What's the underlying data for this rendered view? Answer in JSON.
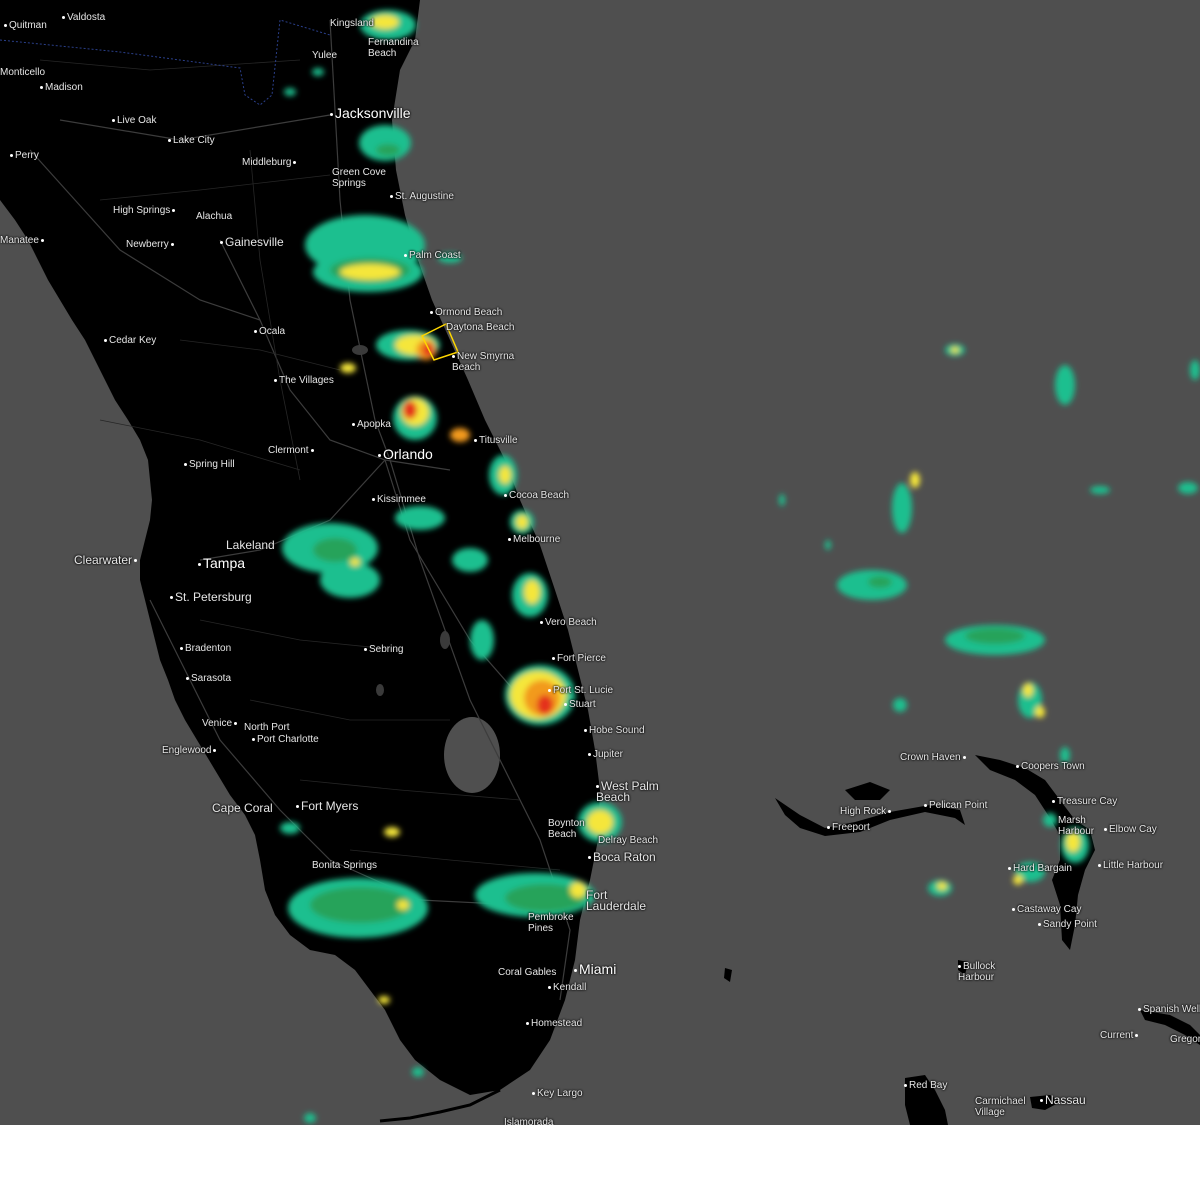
{
  "map": {
    "places": [
      {
        "name": "Valdosta",
        "size": "small"
      },
      {
        "name": "Quitman",
        "size": "small"
      },
      {
        "name": "Madison",
        "size": "small"
      },
      {
        "name": "Live Oak",
        "size": "small"
      },
      {
        "name": "Lake City",
        "size": "small"
      },
      {
        "name": "Perry",
        "size": "small"
      },
      {
        "name": "High Springs",
        "size": "small"
      },
      {
        "name": "Alachua",
        "size": "small"
      },
      {
        "name": "Newberry",
        "size": "small"
      },
      {
        "name": "Gainesville",
        "size": "medium"
      },
      {
        "name": "Cedar Key",
        "size": "small"
      },
      {
        "name": "Ocala",
        "size": "small"
      },
      {
        "name": "The Villages",
        "size": "small"
      },
      {
        "name": "Jacksonville",
        "size": "large"
      },
      {
        "name": "Middleburg",
        "size": "small"
      },
      {
        "name": "Green Cove Springs",
        "size": "small"
      },
      {
        "name": "Yulee",
        "size": "small"
      },
      {
        "name": "St. Augustine",
        "size": "small"
      },
      {
        "name": "Palm Coast",
        "size": "small"
      },
      {
        "name": "Ormond Beach",
        "size": "small"
      },
      {
        "name": "Daytona Beach",
        "size": "small"
      },
      {
        "name": "New Smyrna Beach",
        "size": "small"
      },
      {
        "name": "Apopka",
        "size": "small"
      },
      {
        "name": "Orlando",
        "size": "large"
      },
      {
        "name": "Titusville",
        "size": "small"
      },
      {
        "name": "Clermont",
        "size": "small"
      },
      {
        "name": "Spring Hill",
        "size": "small"
      },
      {
        "name": "Kissimmee",
        "size": "small"
      },
      {
        "name": "Cocoa Beach",
        "size": "small"
      },
      {
        "name": "Melbourne",
        "size": "small"
      },
      {
        "name": "Lakeland",
        "size": "medium"
      },
      {
        "name": "Tampa",
        "size": "large"
      },
      {
        "name": "Clearwater",
        "size": "medium"
      },
      {
        "name": "St. Petersburg",
        "size": "medium"
      },
      {
        "name": "Vero Beach",
        "size": "small"
      },
      {
        "name": "Bradenton",
        "size": "small"
      },
      {
        "name": "Sebring",
        "size": "small"
      },
      {
        "name": "Sarasota",
        "size": "small"
      },
      {
        "name": "Fort Pierce",
        "size": "small"
      },
      {
        "name": "Port St. Lucie",
        "size": "small"
      },
      {
        "name": "Stuart",
        "size": "small"
      },
      {
        "name": "Hobe Sound",
        "size": "small"
      },
      {
        "name": "Venice",
        "size": "small"
      },
      {
        "name": "North Port",
        "size": "small"
      },
      {
        "name": "Port Charlotte",
        "size": "small"
      },
      {
        "name": "Englewood",
        "size": "small"
      },
      {
        "name": "Jupiter",
        "size": "small"
      },
      {
        "name": "West Palm Beach",
        "size": "medium"
      },
      {
        "name": "Cape Coral",
        "size": "medium"
      },
      {
        "name": "Fort Myers",
        "size": "medium"
      },
      {
        "name": "Boynton Beach",
        "size": "small"
      },
      {
        "name": "Delray Beach",
        "size": "small"
      },
      {
        "name": "Boca Raton",
        "size": "medium"
      },
      {
        "name": "Bonita Springs",
        "size": "small"
      },
      {
        "name": "Fort Lauderdale",
        "size": "medium"
      },
      {
        "name": "Pembroke Pines",
        "size": "small"
      },
      {
        "name": "Coral Gables",
        "size": "small"
      },
      {
        "name": "Miami",
        "size": "large"
      },
      {
        "name": "Kendall",
        "size": "small"
      },
      {
        "name": "Homestead",
        "size": "small"
      },
      {
        "name": "Key Largo",
        "size": "small"
      },
      {
        "name": "Islamorada",
        "size": "small"
      },
      {
        "name": "Crown Haven",
        "size": "small"
      },
      {
        "name": "Coopers Town",
        "size": "small"
      },
      {
        "name": "High Rock",
        "size": "small"
      },
      {
        "name": "Pelican Point",
        "size": "small"
      },
      {
        "name": "Freeport",
        "size": "small"
      },
      {
        "name": "Treasure Cay",
        "size": "small"
      },
      {
        "name": "Marsh Harbour",
        "size": "small"
      },
      {
        "name": "Elbow Cay",
        "size": "small"
      },
      {
        "name": "Hard Bargain",
        "size": "small"
      },
      {
        "name": "Little Harbour",
        "size": "small"
      },
      {
        "name": "Castaway Cay",
        "size": "small"
      },
      {
        "name": "Sandy Point",
        "size": "small"
      },
      {
        "name": "Bullock Harbour",
        "size": "small"
      },
      {
        "name": "Spanish Wells",
        "size": "small"
      },
      {
        "name": "Current",
        "size": "small"
      },
      {
        "name": "Gregory Town",
        "size": "small"
      },
      {
        "name": "Red Bay",
        "size": "small"
      },
      {
        "name": "Carmichael Village",
        "size": "small"
      },
      {
        "name": "Nassau",
        "size": "medium"
      },
      {
        "name": "Fernandina Beach",
        "size": "small"
      },
      {
        "name": "Kingsland",
        "size": "small"
      },
      {
        "name": "Monticello",
        "size": "small"
      },
      {
        "name": "Manatee",
        "size": "small"
      }
    ],
    "colors": {
      "ocean": "#4f4f4f",
      "land": "#000000",
      "radar_light": "#1fbf8f",
      "radar_green": "#25a35a",
      "radar_yellow": "#f5e63a",
      "radar_orange": "#f29a1e",
      "radar_red": "#e4321e",
      "warning_box": "#ffd700"
    }
  }
}
